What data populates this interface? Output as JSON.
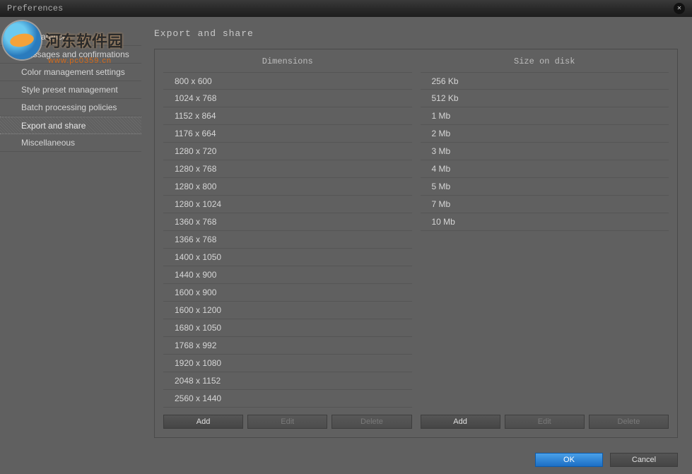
{
  "window": {
    "title": "Preferences"
  },
  "watermark": {
    "main": "河东软件园",
    "sub": "www.pc0359.cn"
  },
  "sidebar": {
    "items": [
      {
        "label": "Appearance"
      },
      {
        "label": "Messages and confirmations"
      },
      {
        "label": "Color management settings"
      },
      {
        "label": "Style preset management"
      },
      {
        "label": "Batch processing policies"
      },
      {
        "label": "Export and share",
        "selected": true
      },
      {
        "label": "Miscellaneous"
      }
    ]
  },
  "panel": {
    "title": "Export and share",
    "columns": {
      "dimensions": {
        "header": "Dimensions",
        "items": [
          "800 x 600",
          "1024 x 768",
          "1152 x 864",
          "1176 x 664",
          "1280 x 720",
          "1280 x 768",
          "1280 x 800",
          "1280 x 1024",
          "1360 x 768",
          "1366 x 768",
          "1400 x 1050",
          "1440 x 900",
          "1600 x 900",
          "1600 x 1200",
          "1680 x 1050",
          "1768 x 992",
          "1920 x 1080",
          "2048 x 1152",
          "2560 x 1440"
        ],
        "buttons": {
          "add": "Add",
          "edit": "Edit",
          "delete": "Delete"
        }
      },
      "size": {
        "header": "Size on disk",
        "items": [
          "256 Kb",
          "512 Kb",
          "1 Mb",
          "2 Mb",
          "3 Mb",
          "4 Mb",
          "5 Mb",
          "7 Mb",
          "10 Mb"
        ],
        "buttons": {
          "add": "Add",
          "edit": "Edit",
          "delete": "Delete"
        }
      }
    }
  },
  "footer": {
    "ok": "OK",
    "cancel": "Cancel"
  }
}
